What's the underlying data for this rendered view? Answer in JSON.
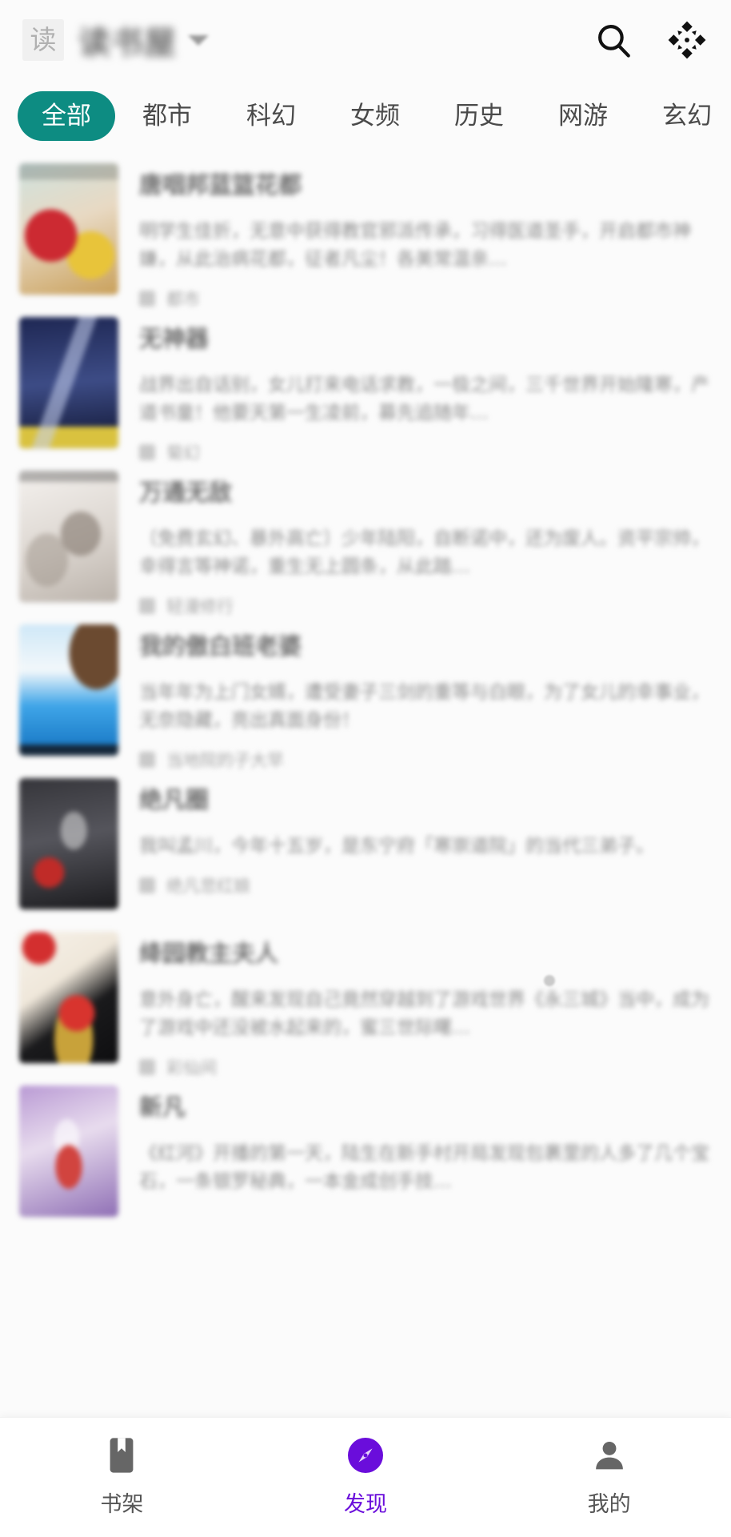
{
  "header": {
    "logo_badge": "读",
    "app_title": "读书屋",
    "dropdown_icon": "chevron-down-icon",
    "search_icon": "search-icon",
    "grid_icon": "diamond-grid-icon"
  },
  "categories": {
    "selected": "全部",
    "items": [
      {
        "label": "全部",
        "active": true
      },
      {
        "label": "都市",
        "active": false
      },
      {
        "label": "科幻",
        "active": false
      },
      {
        "label": "女频",
        "active": false
      },
      {
        "label": "历史",
        "active": false
      },
      {
        "label": "网游",
        "active": false
      },
      {
        "label": "玄幻",
        "active": false
      }
    ]
  },
  "books": [
    {
      "title": "唐咽邦蓝篮花都",
      "desc": "明学生佳折，无意中获得教官邪派传承，习得医道圣手，开启都市神嫌，从此治病花都，征者凡尘！各美常温亲…",
      "author": "都市",
      "cover_top": "#cfe2de",
      "cover_mid": "#e8d9c3",
      "cover_bot": "#c9a05a",
      "cover_accent": "#cc2a32"
    },
    {
      "title": "无神器",
      "desc": "战界出自话别，女儿打来电话求教，一极之间，三千世界开始隆寒，产道书童！他要天第一生凌前，募先追随年…",
      "author": "菊幻",
      "cover_top": "#1e2753",
      "cover_mid": "#3d4c86",
      "cover_bot": "#0f1430",
      "cover_accent": "#d9c23f"
    },
    {
      "title": "万通无敌",
      "desc": "〔免费玄幻、暴外高亡〕少年陆阳，自断诺中，还为废人。资平宗帅，幸得言等神诺，重生无上圆条，从此踏…",
      "author": "轻漫修行",
      "cover_top": "#efeae6",
      "cover_mid": "#d8d2cc",
      "cover_bot": "#b9b0a8",
      "cover_accent": "#8a7f74"
    },
    {
      "title": "我的傲白班老婆",
      "desc": "当年年为上门女婿，遭受妻子三剑的重等与白眼，为了女儿的幸事业，无奈隐藏，亮出真面身份！",
      "author": "当地院的子大早",
      "cover_top": "#bfe1f3",
      "cover_mid": "#3fa5e8",
      "cover_bot": "#1372c0",
      "cover_accent": "#f5f7f8"
    },
    {
      "title": "绝凡圈",
      "desc": "我叫孟川，今年十五岁，是东宁府「寒崇道院」的当代三弟子。",
      "author": "绝凡悲红娘",
      "cover_top": "#2b2b2e",
      "cover_mid": "#4a4a50",
      "cover_bot": "#1b1b1e",
      "cover_accent": "#c02b28"
    },
    {
      "title": "绛园教主夫人",
      "desc": "意外身亡，醒来发现自己竟然穿越到了游戏世界《永三城》当中，成为了游戏中还没被水起来的，蜜三世际曙…",
      "author": "彩仙间",
      "cover_top": "#f2ece3",
      "cover_mid": "#18181a",
      "cover_bot": "#c8a23a",
      "cover_accent": "#d32f2f"
    },
    {
      "title": "新凡",
      "desc": "《红河》开播的第一天，陆生在新手村开局发现包裹里的人多了几个宝石，一条银罗秘典，一本金成创手技…",
      "author": "",
      "cover_top": "#c3a6d8",
      "cover_mid": "#e8dcee",
      "cover_bot": "#8f6fb5",
      "cover_accent": "#d1443f"
    }
  ],
  "bottom_nav": {
    "active_color": "#6a0ddb",
    "inactive_color": "#555555",
    "items": [
      {
        "label": "书架",
        "icon": "bookmark-icon",
        "active": false
      },
      {
        "label": "发现",
        "icon": "compass-icon",
        "active": true
      },
      {
        "label": "我的",
        "icon": "person-icon",
        "active": false
      }
    ]
  }
}
